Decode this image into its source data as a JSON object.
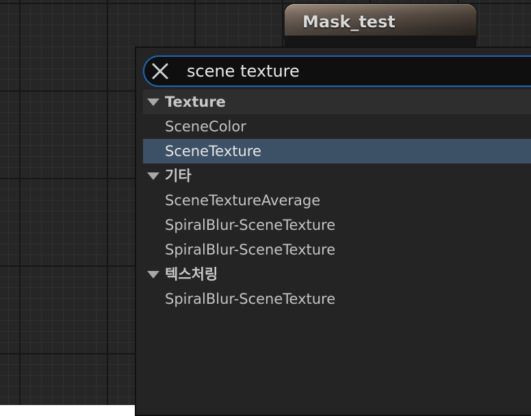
{
  "node": {
    "title": "Mask_test"
  },
  "search": {
    "value": "scene texture",
    "clear_icon": "close-icon"
  },
  "results": [
    {
      "category": "Texture",
      "items": [
        {
          "label": "SceneColor",
          "selected": false
        },
        {
          "label": "SceneTexture",
          "selected": true
        }
      ]
    },
    {
      "category": "기타",
      "items": [
        {
          "label": "SceneTextureAverage",
          "selected": false
        },
        {
          "label": "SpiralBlur-SceneTexture",
          "selected": false
        },
        {
          "label": "SpiralBlur-SceneTexture",
          "selected": false
        }
      ]
    },
    {
      "category": "텍스처링",
      "items": [
        {
          "label": "SpiralBlur-SceneTexture",
          "selected": false
        }
      ]
    }
  ],
  "colors": {
    "accent": "#1c68b8",
    "selection": "#3d5166",
    "background": "#262626"
  }
}
